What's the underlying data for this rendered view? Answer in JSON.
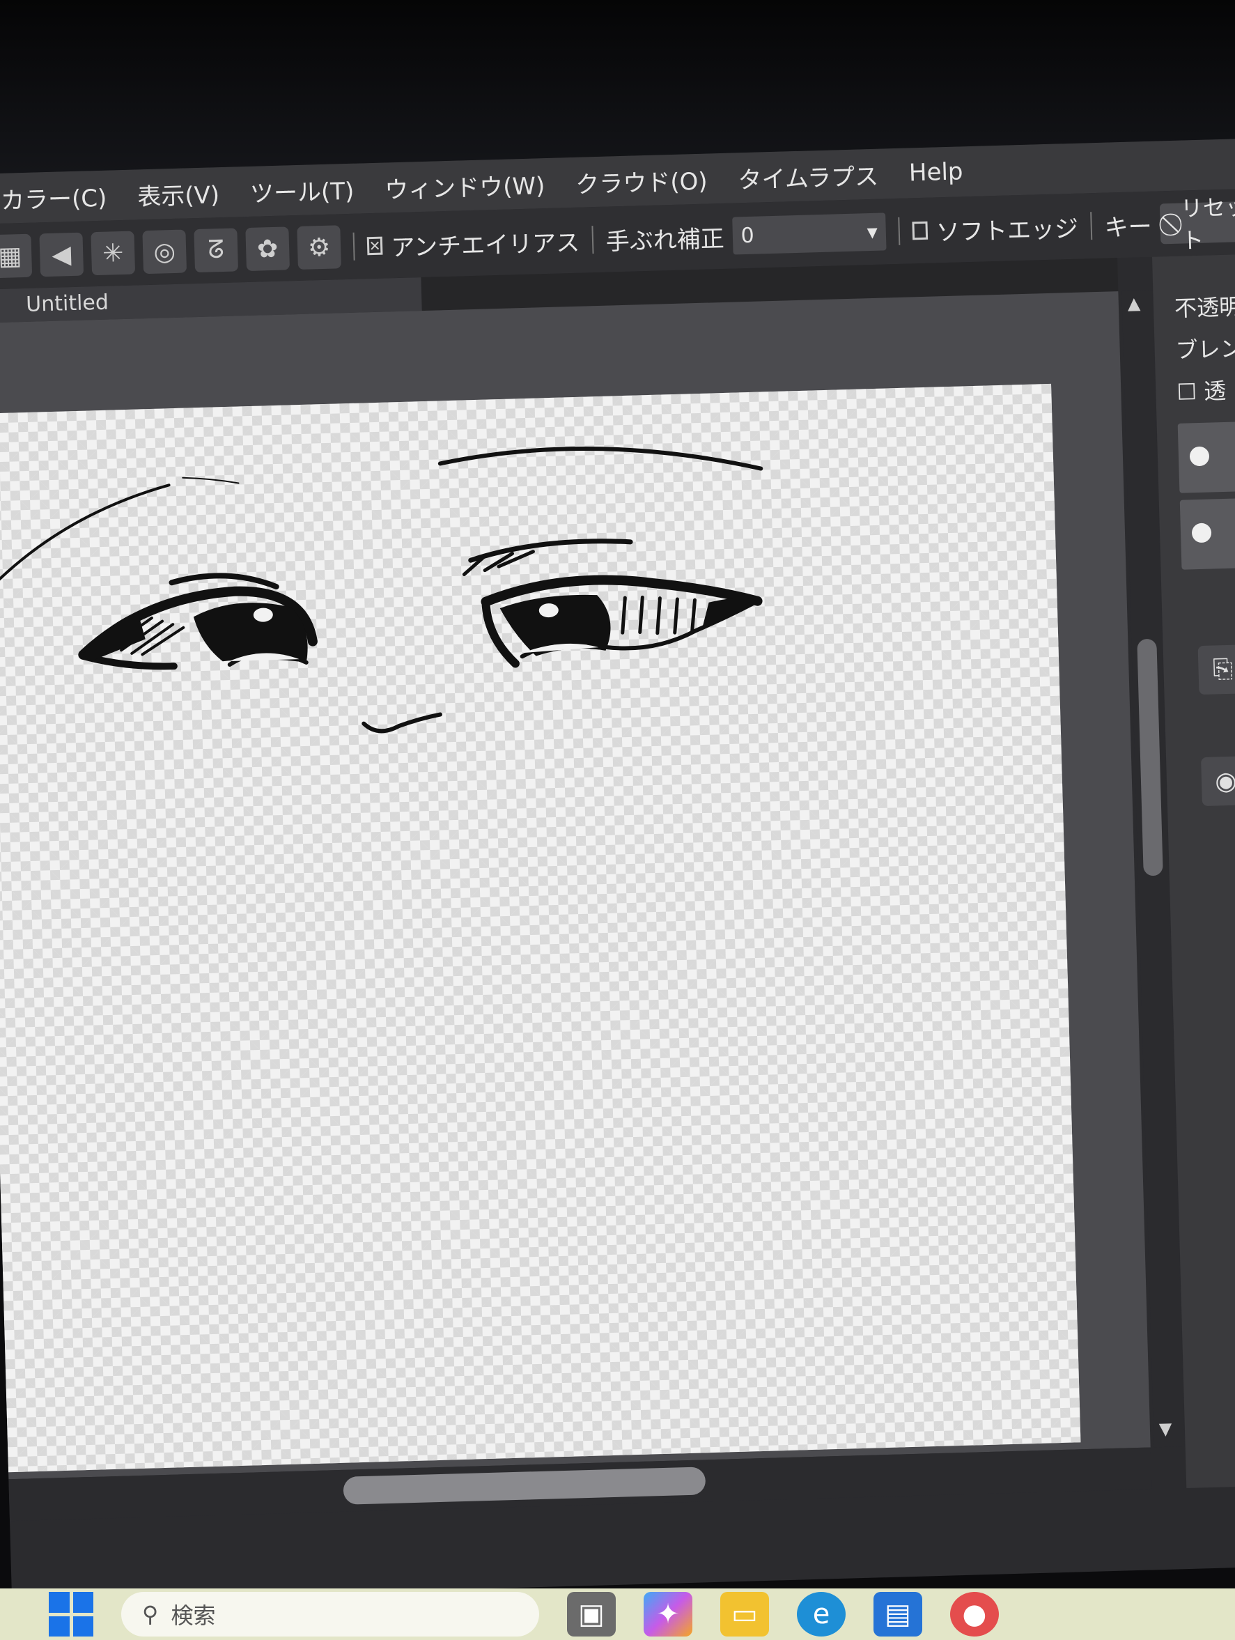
{
  "menu": {
    "items": [
      "カラー(C)",
      "表示(V)",
      "ツール(T)",
      "ウィンドウ(W)",
      "クラウド(O)",
      "タイムラプス",
      "Help"
    ]
  },
  "toolbar": {
    "antialias_label": "アンチエイリアス",
    "stabilizer_label": "手ぶれ補正",
    "stabilizer_value": "0",
    "soft_edge_label": "ソフトエッジ",
    "key_label": "キー",
    "reset_label": "リセット"
  },
  "document": {
    "tab_title": "Untitled"
  },
  "panel": {
    "opacity_label": "不透明",
    "blend_label": "ブレン",
    "protect_label": "透"
  },
  "taskbar": {
    "search_placeholder": "検索"
  },
  "colors": {
    "menubar": "#3a3a3d",
    "toolbar": "#2f2f32",
    "workspace": "#4b4b4f",
    "taskbar": "#e3e6c8",
    "start_blue": "#1a73e8"
  }
}
